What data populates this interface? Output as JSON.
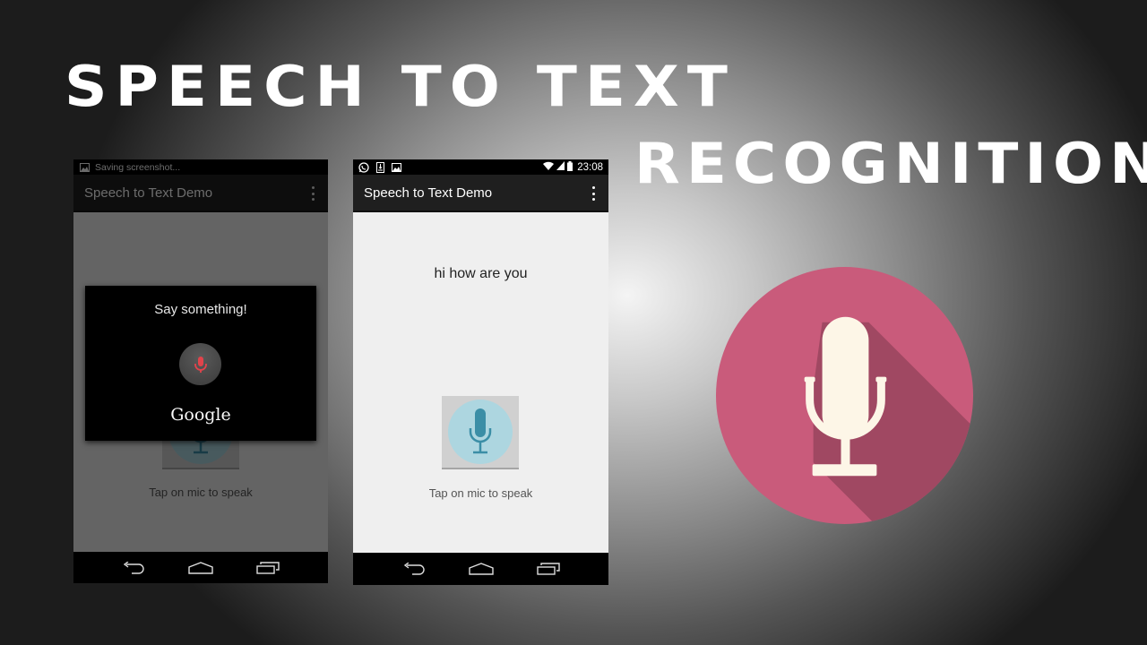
{
  "headline": {
    "line1": "SPEECH TO TEXT",
    "line2": "RECOGNITION"
  },
  "phone_left": {
    "status_bar": {
      "notification_icon": "image-icon",
      "notification_text": "Saving screenshot..."
    },
    "action_bar": {
      "title": "Speech to Text Demo",
      "menu_icon": "overflow-menu-icon"
    },
    "content": {
      "mic_button_icon": "microphone-icon",
      "hint": "Tap on mic to speak"
    },
    "dialog": {
      "prompt": "Say something!",
      "mic_icon": "microphone-icon",
      "brand": "Google",
      "mic_color": "#e2434b"
    },
    "nav": [
      "back-icon",
      "home-icon",
      "recents-icon"
    ]
  },
  "phone_right": {
    "status_bar": {
      "left_icons": [
        "whatsapp-icon",
        "download-icon",
        "image-icon"
      ],
      "right_icons": [
        "wifi-icon",
        "signal-icon",
        "battery-icon"
      ],
      "time": "23:08"
    },
    "action_bar": {
      "title": "Speech to Text Demo",
      "menu_icon": "overflow-menu-icon"
    },
    "content": {
      "result_text": "hi how are you",
      "mic_button_icon": "microphone-icon",
      "hint": "Tap on mic to speak"
    },
    "nav": [
      "back-icon",
      "home-icon",
      "recents-icon"
    ]
  },
  "colors": {
    "mic_circle_bg": "#add6e0",
    "mic_fill": "#3b8ea6",
    "brand_badge": "#c95b7b",
    "brand_badge_shadow": "#a04862",
    "brand_mic": "#fdf6e7"
  }
}
